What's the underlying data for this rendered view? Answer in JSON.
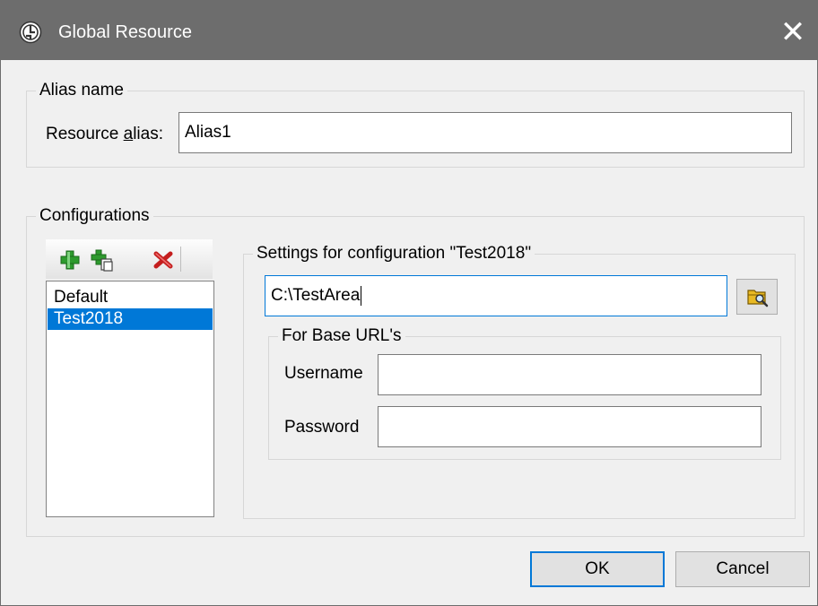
{
  "window": {
    "title": "Global Resource",
    "close_symbol": "✕"
  },
  "alias_group": {
    "legend": "Alias name",
    "label_prefix": "Resource ",
    "label_underlined": "a",
    "label_suffix": "lias:",
    "value": "Alias1"
  },
  "configurations": {
    "legend": "Configurations",
    "toolbar": {
      "add_icon": "add-configuration-icon",
      "copy_icon": "copy-configuration-icon",
      "delete_icon": "delete-configuration-icon"
    },
    "items": [
      {
        "label": "Default",
        "selected": false
      },
      {
        "label": "Test2018",
        "selected": true
      }
    ],
    "settings": {
      "legend": "Settings for configuration \"Test2018\"",
      "path_value": "C:\\TestArea",
      "browse_icon": "browse-folder-icon",
      "base_url": {
        "legend": "For Base URL's",
        "username_label": "Username",
        "username_value": "",
        "password_label": "Password",
        "password_value": ""
      }
    }
  },
  "buttons": {
    "ok": "OK",
    "cancel": "Cancel"
  },
  "colors": {
    "titlebar": "#6d6d6d",
    "selection": "#0078d7",
    "focus_border": "#0078d7",
    "background": "#f0f0f0"
  }
}
